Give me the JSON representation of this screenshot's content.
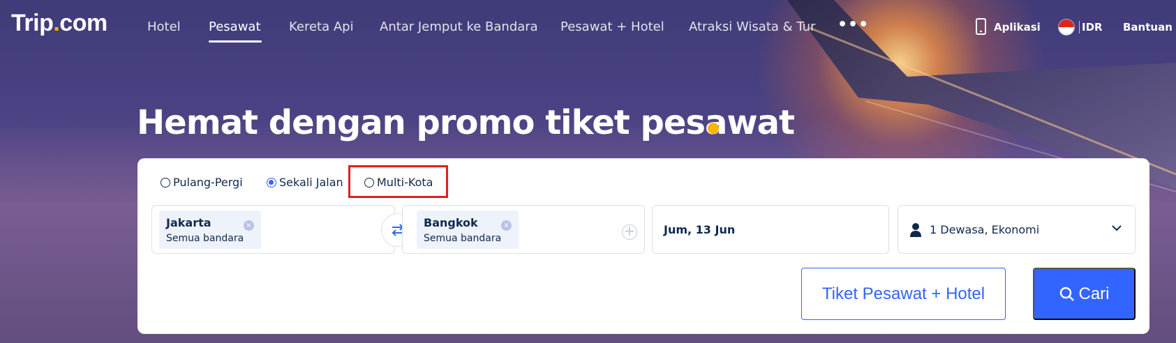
{
  "brand": {
    "logo_main": "Trip",
    "logo_dot": ".",
    "logo_tld": "com",
    "accent_color": "#ffb400",
    "primary_color": "#3264ff"
  },
  "nav": {
    "items": [
      {
        "label": "Hotel"
      },
      {
        "label": "Pesawat",
        "active": true
      },
      {
        "label": "Kereta Api"
      },
      {
        "label": "Antar Jemput ke Bandara"
      },
      {
        "label": "Pesawat + Hotel"
      },
      {
        "label": "Atraksi Wisata & Tur"
      }
    ],
    "more_label": "•••",
    "app_label": "Aplikasi",
    "currency_label": "IDR",
    "help_label": "Bantuan"
  },
  "hero": {
    "title": "Hemat dengan promo tiket pesawat"
  },
  "search": {
    "trip_types": [
      {
        "label": "Pulang-Pergi",
        "checked": false
      },
      {
        "label": "Sekali Jalan",
        "checked": true
      },
      {
        "label": "Multi-Kota",
        "checked": false
      }
    ],
    "origin": {
      "city": "Jakarta",
      "airport": "Semua bandara"
    },
    "destination": {
      "city": "Bangkok",
      "airport": "Semua bandara"
    },
    "date": "Jum, 13 Jun",
    "passengers": "1 Dewasa, Ekonomi",
    "flight_hotel_button": "Tiket Pesawat + Hotel",
    "search_button": "Cari"
  }
}
